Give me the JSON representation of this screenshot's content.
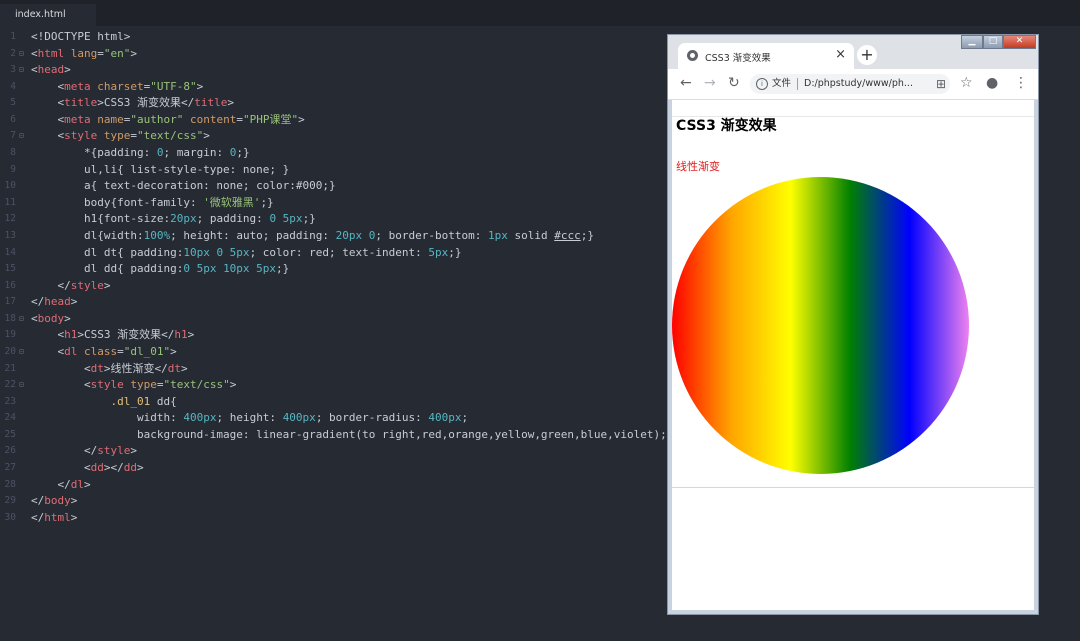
{
  "editor": {
    "tab_label": "index.html",
    "lines": [
      {
        "n": "1",
        "fold": "",
        "seg": [
          [
            "c",
            "<!DOCTYPE html>"
          ]
        ]
      },
      {
        "n": "2",
        "fold": "⊟",
        "seg": [
          [
            "c",
            "<"
          ],
          [
            "t",
            "html"
          ],
          [
            "a",
            " lang"
          ],
          [
            "c",
            "="
          ],
          [
            "s",
            "\"en\""
          ],
          [
            "c",
            ">"
          ]
        ]
      },
      {
        "n": "3",
        "fold": "⊟",
        "seg": [
          [
            "c",
            "<"
          ],
          [
            "t",
            "head"
          ],
          [
            "c",
            ">"
          ]
        ]
      },
      {
        "n": "4",
        "fold": "",
        "seg": [
          [
            "c",
            "    <"
          ],
          [
            "t",
            "meta"
          ],
          [
            "a",
            " charset"
          ],
          [
            "c",
            "="
          ],
          [
            "s",
            "\"UTF-8\""
          ],
          [
            "c",
            ">"
          ]
        ]
      },
      {
        "n": "5",
        "fold": "",
        "seg": [
          [
            "c",
            "    <"
          ],
          [
            "t",
            "title"
          ],
          [
            "c",
            ">CSS3 渐变效果</"
          ],
          [
            "t",
            "title"
          ],
          [
            "c",
            ">"
          ]
        ]
      },
      {
        "n": "6",
        "fold": "",
        "seg": [
          [
            "c",
            "    <"
          ],
          [
            "t",
            "meta"
          ],
          [
            "a",
            " name"
          ],
          [
            "c",
            "="
          ],
          [
            "s",
            "\"author\""
          ],
          [
            "a",
            " content"
          ],
          [
            "c",
            "="
          ],
          [
            "s",
            "\"PHP课堂\""
          ],
          [
            "c",
            ">"
          ]
        ]
      },
      {
        "n": "7",
        "fold": "⊟",
        "seg": [
          [
            "c",
            "    <"
          ],
          [
            "t",
            "style"
          ],
          [
            "a",
            " type"
          ],
          [
            "c",
            "="
          ],
          [
            "s",
            "\"text/css\""
          ],
          [
            "c",
            ">"
          ]
        ]
      },
      {
        "n": "8",
        "fold": "",
        "seg": [
          [
            "c",
            "        *{padding: "
          ],
          [
            "n",
            "0"
          ],
          [
            "c",
            "; margin: "
          ],
          [
            "n",
            "0"
          ],
          [
            "c",
            ";}"
          ]
        ]
      },
      {
        "n": "9",
        "fold": "",
        "seg": [
          [
            "c",
            "        ul,li{ list-style-type: none; }"
          ]
        ]
      },
      {
        "n": "10",
        "fold": "",
        "seg": [
          [
            "c",
            "        a{ text-decoration: none; color:#000;}"
          ]
        ]
      },
      {
        "n": "11",
        "fold": "",
        "seg": [
          [
            "c",
            "        body{font-family: "
          ],
          [
            "s",
            "'微软雅黑'"
          ],
          [
            "c",
            ";}"
          ]
        ]
      },
      {
        "n": "12",
        "fold": "",
        "seg": [
          [
            "c",
            "        h1{font-size:"
          ],
          [
            "n",
            "20px"
          ],
          [
            "c",
            "; padding: "
          ],
          [
            "n",
            "0 5px"
          ],
          [
            "c",
            ";}"
          ]
        ]
      },
      {
        "n": "13",
        "fold": "",
        "seg": [
          [
            "c",
            "        dl{width:"
          ],
          [
            "n",
            "100%"
          ],
          [
            "c",
            "; height: auto; padding: "
          ],
          [
            "n",
            "20px 0"
          ],
          [
            "c",
            "; border-bottom: "
          ],
          [
            "n",
            "1px"
          ],
          [
            "c",
            " solid "
          ],
          [
            "u",
            "#ccc"
          ],
          [
            "c",
            ";}"
          ]
        ]
      },
      {
        "n": "14",
        "fold": "",
        "seg": [
          [
            "c",
            "        dl dt{ padding:"
          ],
          [
            "n",
            "10px 0 5px"
          ],
          [
            "c",
            "; color: red; text-indent: "
          ],
          [
            "n",
            "5px"
          ],
          [
            "c",
            ";}"
          ]
        ]
      },
      {
        "n": "15",
        "fold": "",
        "seg": [
          [
            "c",
            "        dl dd{ padding:"
          ],
          [
            "n",
            "0 5px 10px 5px"
          ],
          [
            "c",
            ";}"
          ]
        ]
      },
      {
        "n": "16",
        "fold": "",
        "seg": [
          [
            "c",
            "    </"
          ],
          [
            "t",
            "style"
          ],
          [
            "c",
            ">"
          ]
        ]
      },
      {
        "n": "17",
        "fold": "",
        "seg": [
          [
            "c",
            "</"
          ],
          [
            "t",
            "head"
          ],
          [
            "c",
            ">"
          ]
        ]
      },
      {
        "n": "18",
        "fold": "⊟",
        "seg": [
          [
            "c",
            "<"
          ],
          [
            "t",
            "body"
          ],
          [
            "c",
            ">"
          ]
        ]
      },
      {
        "n": "19",
        "fold": "",
        "seg": [
          [
            "c",
            "    <"
          ],
          [
            "t",
            "h1"
          ],
          [
            "c",
            ">CSS3 渐变效果</"
          ],
          [
            "t",
            "h1"
          ],
          [
            "c",
            ">"
          ]
        ]
      },
      {
        "n": "20",
        "fold": "⊟",
        "seg": [
          [
            "c",
            "    <"
          ],
          [
            "t",
            "dl"
          ],
          [
            "a",
            " class"
          ],
          [
            "c",
            "="
          ],
          [
            "s",
            "\"dl_01\""
          ],
          [
            "c",
            ">"
          ]
        ]
      },
      {
        "n": "21",
        "fold": "",
        "seg": [
          [
            "c",
            "        <"
          ],
          [
            "t",
            "dt"
          ],
          [
            "c",
            ">线性渐变</"
          ],
          [
            "t",
            "dt"
          ],
          [
            "c",
            ">"
          ]
        ]
      },
      {
        "n": "22",
        "fold": "⊟",
        "seg": [
          [
            "c",
            "        <"
          ],
          [
            "t",
            "style"
          ],
          [
            "a",
            " type"
          ],
          [
            "c",
            "="
          ],
          [
            "s",
            "\"text/css\""
          ],
          [
            "c",
            ">"
          ]
        ]
      },
      {
        "n": "23",
        "fold": "",
        "seg": [
          [
            "k",
            "            .dl_01"
          ],
          [
            "c",
            " dd{"
          ]
        ]
      },
      {
        "n": "24",
        "fold": "",
        "seg": [
          [
            "c",
            "                width: "
          ],
          [
            "n",
            "400px"
          ],
          [
            "c",
            "; height: "
          ],
          [
            "n",
            "400px"
          ],
          [
            "c",
            "; border-radius: "
          ],
          [
            "n",
            "400px"
          ],
          [
            "c",
            ";"
          ]
        ]
      },
      {
        "n": "25",
        "fold": "",
        "seg": [
          [
            "c",
            "                background-image: linear-gradient(to right,red,orange,yellow,green,blue,violet);}"
          ]
        ]
      },
      {
        "n": "26",
        "fold": "",
        "seg": [
          [
            "c",
            "        </"
          ],
          [
            "t",
            "style"
          ],
          [
            "c",
            ">"
          ]
        ]
      },
      {
        "n": "27",
        "fold": "",
        "seg": [
          [
            "c",
            "        <"
          ],
          [
            "t",
            "dd"
          ],
          [
            "c",
            "></"
          ],
          [
            "t",
            "dd"
          ],
          [
            "c",
            ">"
          ]
        ]
      },
      {
        "n": "28",
        "fold": "",
        "seg": [
          [
            "c",
            "    </"
          ],
          [
            "t",
            "dl"
          ],
          [
            "c",
            ">"
          ]
        ]
      },
      {
        "n": "29",
        "fold": "",
        "seg": [
          [
            "c",
            "</"
          ],
          [
            "t",
            "body"
          ],
          [
            "c",
            ">"
          ]
        ]
      },
      {
        "n": "30",
        "fold": "",
        "seg": [
          [
            "c",
            "</"
          ],
          [
            "t",
            "html"
          ],
          [
            "c",
            ">"
          ]
        ]
      }
    ]
  },
  "browser": {
    "tab_title": "CSS3 渐变效果",
    "tab_close": "×",
    "new_tab": "+",
    "window_min": "▁",
    "window_max": "□",
    "window_close": "✕",
    "back": "←",
    "forward": "→",
    "reload": "↻",
    "info": "i",
    "file_label": "文件",
    "url": "D:/phpstudy/www/ph...",
    "translate": "⊞",
    "star": "☆",
    "profile": "●",
    "menu": "⋮",
    "page_heading": "CSS3 渐变效果",
    "dt_label": "线性渐变",
    "gradient_colors": [
      "red",
      "orange",
      "yellow",
      "green",
      "blue",
      "violet"
    ]
  },
  "colors": {
    "tag": "#e06c75",
    "attr": "#d19a66",
    "string": "#98c379",
    "number": "#56b6c2",
    "text": "#c8ccd4",
    "selector": "#e5c07b"
  }
}
